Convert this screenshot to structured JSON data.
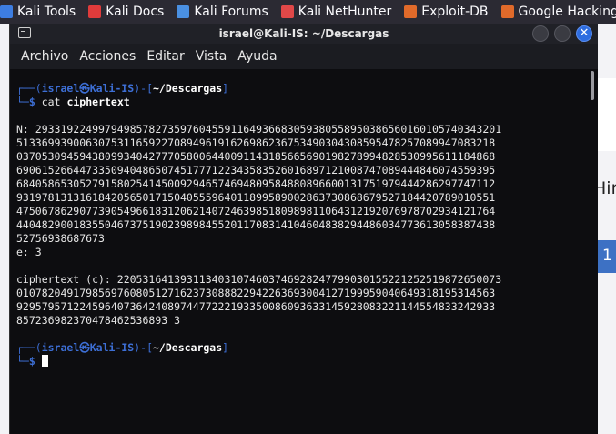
{
  "bookmarks": [
    {
      "label": "Kali Tools",
      "icon": "kali-icon",
      "color": "#3d7de0"
    },
    {
      "label": "Kali Docs",
      "icon": "docs-icon",
      "color": "#e03b3b"
    },
    {
      "label": "Kali Forums",
      "icon": "forums-icon",
      "color": "#4a90e2"
    },
    {
      "label": "Kali NetHunter",
      "icon": "nethunter-icon",
      "color": "#e04848"
    },
    {
      "label": "Exploit-DB",
      "icon": "exploitdb-icon",
      "color": "#e06a2a"
    },
    {
      "label": "Google Hacking DB",
      "icon": "ghdb-icon",
      "color": "#e06a2a"
    }
  ],
  "behind": {
    "hint": "Hin",
    "one": "1"
  },
  "terminal": {
    "title": "israel@Kali-IS: ~/Descargas",
    "menu": [
      "Archivo",
      "Acciones",
      "Editar",
      "Vista",
      "Ayuda"
    ],
    "prompt": {
      "frame_top": "┌──(",
      "user_host": "israel㉿Kali-IS",
      "mid": ")-[",
      "path": "~/Descargas",
      "end": "]",
      "frame_bottom": "└─",
      "dollar": "$"
    },
    "command": {
      "cmd": "cat",
      "arg": "ciphertext"
    },
    "output": [
      "N: 29331922499794985782735976045591164936683059380558950386560160105740343201",
      "5133699390063075311659227089496191626986236753490304308595478257089947083218",
      "0370530945943809934042777058006440091143185665690198278994828530995611184868",
      "6906152664473350940486507451777122343583526016897121008747089444846074559395",
      "6840586530527915802541450092946574694809584880896600131751979444286297747112",
      "9319781313161842056501715040555964011899589002863730868679527184420789010551",
      "4750678629077390549661831206214072463985180989811064312192076978702934121764",
      "4404829001835504673751902398984552011708314104604838294486034773613058387438",
      "52756938687673",
      "e: 3",
      "",
      "ciphertext (c): 2205316413931134031074603746928247799030155221252519872650073",
      "0107820491798569760805127162373088822942263693004127199959040649318195314563",
      "9295795712245964073642408974477222193350086093633145928083221144554833242933",
      "857236982370478462536893 3"
    ]
  }
}
